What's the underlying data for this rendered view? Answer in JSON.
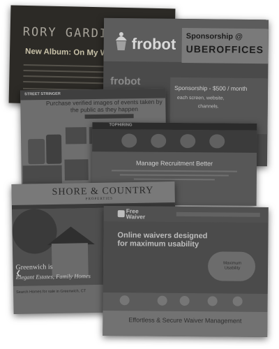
{
  "cards": {
    "rory": {
      "title": "RORY GARDINER",
      "subtitle": "New Album: On My Way"
    },
    "frobot": {
      "logo": "frobot",
      "sponsor_line1": "Sponsorship @",
      "sponsor_line2": "UBEROFFICES",
      "logo2": "frobot",
      "sponsor_price": "Sponsorship - $500 / month",
      "reach_line": "each screen, website,",
      "channels": "channels."
    },
    "purchase": {
      "brand": "STREET STRINGER",
      "headline": "Purchase verified images of events taken by the public as they happen"
    },
    "recruit": {
      "brand": "TOPHIRING",
      "headline": "Manage Recruitment Better"
    },
    "shore": {
      "logo": "SHORE & COUNTRY",
      "logo_sub": "PROPERTIES",
      "town": "Greenwich is",
      "tagline": "Elegant Estates, Family Homes",
      "search_label": "Search Homes for sale in Greenwich, CT"
    },
    "waiver": {
      "logo_line1": "Free",
      "logo_line2": "Waiver",
      "headline_line1": "Online waivers designed",
      "headline_line2": "for maximum usability",
      "cloud_text": "Maximum Usability",
      "footer_heading": "Effortless & Secure Waiver Management"
    }
  },
  "colors": {
    "page_background": "#ffffff",
    "card_overlay": "#4a4a4a"
  }
}
